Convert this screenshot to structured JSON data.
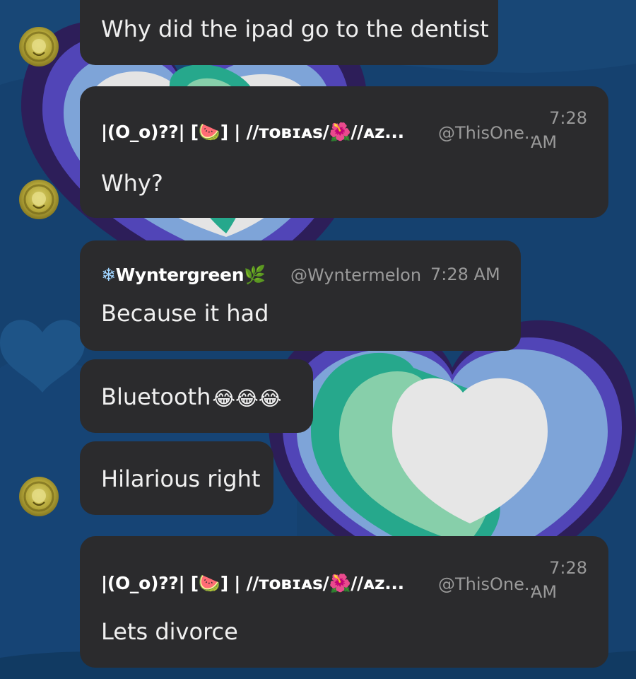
{
  "messages": [
    {
      "text": "Why did the ipad go to the dentist"
    },
    {
      "author_name": "|(O_o)??| [🍉] | //ᴛᴏʙɪᴀs/🌺//ᴀᴢ...",
      "author_handle": "@ThisOne...",
      "time_line1": "7:28",
      "time_line2": "AM",
      "text": "Why?"
    },
    {
      "author_prefix": "❄",
      "author_name": "Wyntergreen",
      "author_suffix": "🌿",
      "author_handle": "@Wyntermelon",
      "time": "7:28 AM",
      "text": "Because it had"
    },
    {
      "text": "Bluetooth",
      "emoji": "😂😂😂"
    },
    {
      "text": "Hilarious right"
    },
    {
      "author_name": "|(O_o)??| [🍉] | //ᴛᴏʙɪᴀs/🌺//ᴀᴢ...",
      "author_handle": "@ThisOne...",
      "time_line1": "7:28",
      "time_line2": "AM",
      "text": "Lets divorce"
    }
  ],
  "icons": {
    "avatar": "lion-avatar-icon",
    "laugh": "laughing-crying-emoji-icon",
    "snowflake": "snowflake-icon",
    "herb": "herb-icon"
  },
  "colors": {
    "background": "#14406e",
    "bubble": "#2b2b2d",
    "text": "#f0f0f0",
    "meta": "#9a9a9a"
  }
}
